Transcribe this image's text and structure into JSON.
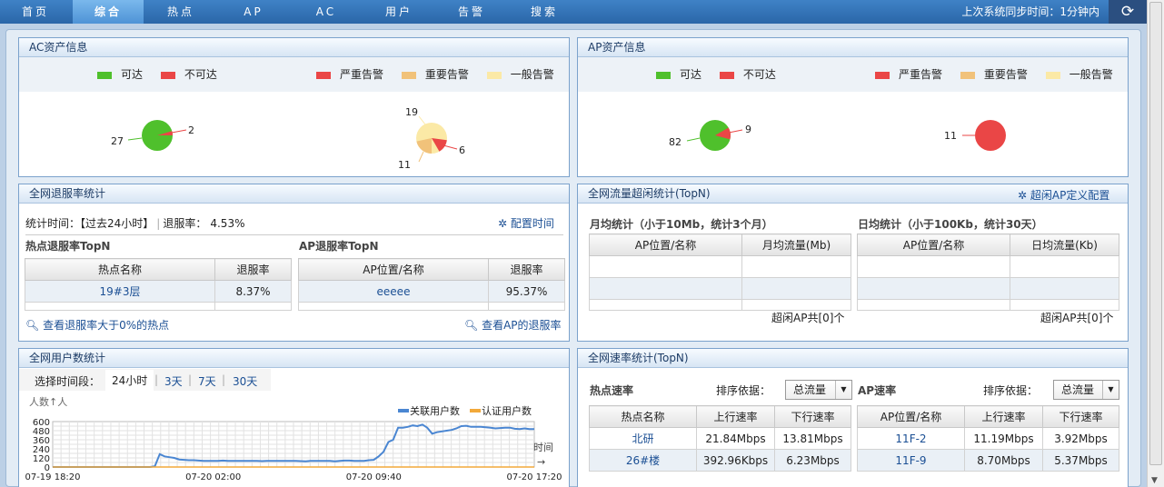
{
  "nav": {
    "items": [
      "首页",
      "综合",
      "热点",
      "AP",
      "AC",
      "用户",
      "告警",
      "搜索"
    ],
    "active_index": 1,
    "sync_text": "上次系统同步时间：1分钟内",
    "refresh_icon": "refresh-icon"
  },
  "colors": {
    "green": "#4fc02c",
    "red": "#ea4646",
    "orange": "#f1c27a",
    "yellow": "#fbe9a6",
    "accent": "#2a66a8",
    "blue_line": "#4a86d2",
    "orange_line": "#f2a93a"
  },
  "ac_panel": {
    "title": "AC资产信息",
    "legend_left": [
      {
        "label": "可达",
        "color": "#4fc02c"
      },
      {
        "label": "不可达",
        "color": "#ea4646"
      }
    ],
    "legend_right": [
      {
        "label": "严重告警",
        "color": "#ea4646"
      },
      {
        "label": "重要告警",
        "color": "#f1c27a"
      },
      {
        "label": "一般告警",
        "color": "#fbe9a6"
      }
    ],
    "reach_pie": {
      "reachable": "27",
      "unreachable": "2"
    },
    "alarm_pie": {
      "critical": "6",
      "major": "11",
      "minor": "19"
    }
  },
  "ap_panel": {
    "title": "AP资产信息",
    "legend_left": [
      {
        "label": "可达",
        "color": "#4fc02c"
      },
      {
        "label": "不可达",
        "color": "#ea4646"
      }
    ],
    "legend_right": [
      {
        "label": "严重告警",
        "color": "#ea4646"
      },
      {
        "label": "重要告警",
        "color": "#f1c27a"
      },
      {
        "label": "一般告警",
        "color": "#fbe9a6"
      }
    ],
    "reach_pie": {
      "reachable": "82",
      "unreachable": "9"
    },
    "alarm_pie": {
      "critical": "11"
    }
  },
  "offline": {
    "title": "全网退服率统计",
    "stat_label": "统计时间：",
    "stat_period": "【过去24小时】",
    "rate_label": "退服率：",
    "rate_value": "4.53%",
    "config_link": "配置时间",
    "hotspot_heading": "热点退服率TopN",
    "ap_heading": "AP退服率TopN",
    "hotspot_cols": [
      "热点名称",
      "退服率"
    ],
    "hotspot_rows": [
      [
        "19#3层",
        "8.37%"
      ]
    ],
    "ap_cols": [
      "AP位置/名称",
      "退服率"
    ],
    "ap_rows": [
      [
        "eeeee",
        "95.37%"
      ]
    ],
    "hotspot_link": "查看退服率大于0%的热点",
    "ap_link": "查看AP的退服率"
  },
  "idle": {
    "title": "全网流量超闲统计(TopN)",
    "config_link": "超闲AP定义配置",
    "monthly_heading": "月均统计（小于10Mb，统计3个月）",
    "daily_heading": "日均统计（小于100Kb，统计30天）",
    "monthly_cols": [
      "AP位置/名称",
      "月均流量(Mb)"
    ],
    "daily_cols": [
      "AP位置/名称",
      "日均流量(Kb)"
    ],
    "monthly_total": "超闲AP共[0]个",
    "daily_total": "超闲AP共[0]个"
  },
  "users": {
    "title": "全网用户数统计",
    "range_label": "选择时间段：",
    "ranges": [
      "24小时",
      "3天",
      "7天",
      "30天"
    ],
    "selected_range": "24小时"
  },
  "rate": {
    "title": "全网速率统计(TopN)",
    "hotspot_heading": "热点速率",
    "ap_heading": "AP速率",
    "sort_label": "排序依据：",
    "sort_value": "总流量",
    "hotspot_cols": [
      "热点名称",
      "上行速率",
      "下行速率"
    ],
    "hotspot_rows": [
      [
        "北研",
        "21.84Mbps",
        "13.81Mbps"
      ],
      [
        "26#楼",
        "392.96Kbps",
        "6.23Mbps"
      ]
    ],
    "ap_cols": [
      "AP位置/名称",
      "上行速率",
      "下行速率"
    ],
    "ap_rows": [
      [
        "11F-2",
        "11.19Mbps",
        "3.92Mbps"
      ],
      [
        "11F-9",
        "8.70Mbps",
        "5.37Mbps"
      ]
    ]
  },
  "chart_data": {
    "type": "line",
    "ylabel": "人数↑人",
    "xlabel": "时间",
    "yticks": [
      "600",
      "480",
      "360",
      "240",
      "120",
      "0"
    ],
    "ylim": [
      0,
      600
    ],
    "xticks": [
      "07-19 18:20",
      "07-20 02:00",
      "07-20 09:40",
      "07-20 17:20"
    ],
    "grid": true,
    "legend_position": "top-right",
    "series": [
      {
        "name": "关联用户数",
        "color": "#4a86d2",
        "values": [
          0,
          0,
          0,
          0,
          0,
          0,
          0,
          0,
          0,
          0,
          0,
          0,
          0,
          0,
          0,
          0,
          0,
          0,
          0,
          0,
          0,
          10,
          170,
          140,
          130,
          120,
          100,
          95,
          90,
          90,
          85,
          80,
          80,
          80,
          80,
          85,
          80,
          80,
          80,
          80,
          80,
          80,
          80,
          78,
          80,
          80,
          80,
          80,
          80,
          80,
          80,
          78,
          75,
          80,
          80,
          80,
          80,
          80,
          75,
          80,
          85,
          85,
          80,
          80,
          80,
          90,
          95,
          140,
          200,
          330,
          360,
          520,
          520,
          530,
          550,
          540,
          560,
          520,
          440,
          460,
          470,
          480,
          490,
          510,
          540,
          545,
          530,
          530,
          530,
          525,
          520,
          510,
          515,
          520,
          520,
          505,
          500,
          510,
          500,
          500
        ]
      },
      {
        "name": "认证用户数",
        "color": "#f2a93a",
        "values": [
          0,
          0,
          0,
          0,
          0,
          0,
          0,
          0,
          0,
          0,
          0,
          0,
          0,
          0,
          0,
          0,
          0,
          0,
          0,
          0,
          0,
          0,
          0,
          0,
          0,
          0,
          0,
          0,
          0,
          0,
          0,
          0,
          0,
          0,
          0,
          0,
          0,
          0,
          0,
          0,
          0,
          0,
          0,
          0,
          0,
          0,
          0,
          0,
          0,
          0,
          0,
          0,
          0,
          0,
          0,
          0,
          0,
          0,
          0,
          0,
          0,
          0,
          0,
          0,
          0,
          0,
          0,
          0,
          0,
          0,
          0,
          0,
          0,
          0,
          0,
          0,
          0,
          0,
          0,
          0,
          0,
          0,
          0,
          0,
          0,
          0,
          0,
          0,
          0,
          0,
          0,
          0,
          0,
          0,
          0,
          0,
          0,
          0,
          0,
          0
        ]
      }
    ]
  }
}
